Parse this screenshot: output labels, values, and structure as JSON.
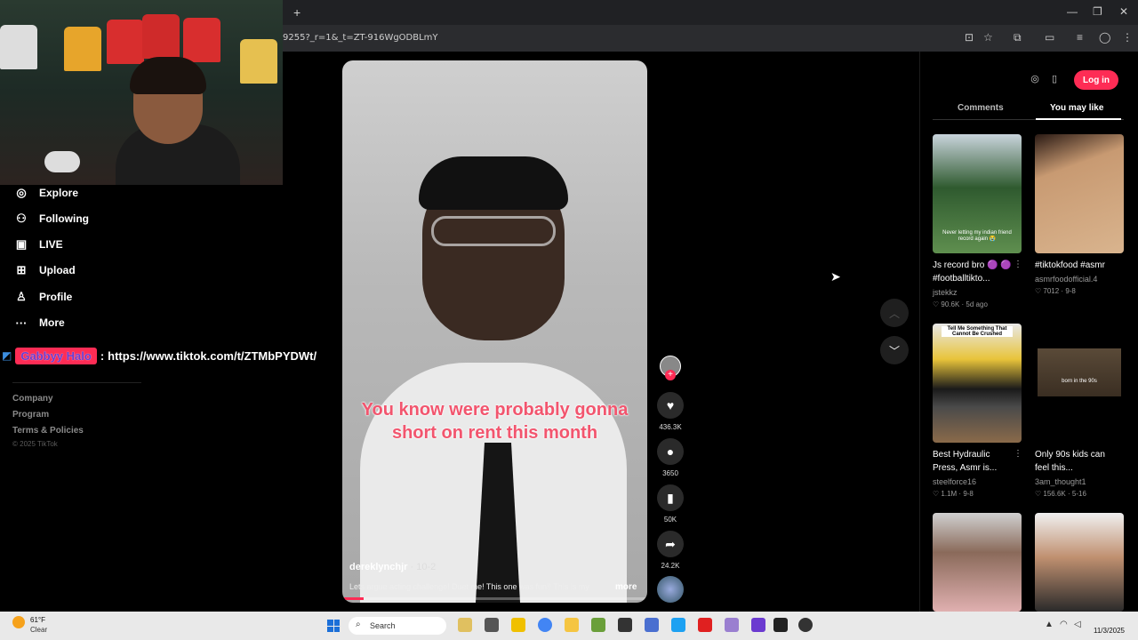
{
  "browser": {
    "new_tab_label": "+",
    "url": "9255?_r=1&_t=ZT-916WgODBLmY",
    "window_controls": [
      "—",
      "❐",
      "✕"
    ]
  },
  "nav": {
    "items": [
      {
        "label": "Explore",
        "icon": "compass-icon"
      },
      {
        "label": "Following",
        "icon": "following-icon"
      },
      {
        "label": "LIVE",
        "icon": "live-icon"
      },
      {
        "label": "Upload",
        "icon": "upload-icon"
      },
      {
        "label": "Profile",
        "icon": "profile-icon"
      },
      {
        "label": "More",
        "icon": "more-icon"
      }
    ],
    "footer_links": [
      "Company",
      "Program",
      "Terms & Policies"
    ],
    "copyright": "© 2025 TikTok"
  },
  "stream_overlay": {
    "name": "Gabbyy Halo",
    "separator": ":",
    "link": "https://www.tiktok.com/t/ZTMbPYDWt/"
  },
  "video": {
    "caption": "You know were probably gonna short on rent this month",
    "author": "dereklynchjr",
    "date": " · 10-2",
    "description": "Lets argue acting challenge! Duet me! This one was fun!! This is my",
    "more_label": "more",
    "progress": 0.07
  },
  "actions": {
    "likes": "436.3K",
    "comments": "3650",
    "saves": "50K",
    "shares": "24.2K"
  },
  "right_panel": {
    "login_label": "Log in",
    "tabs": [
      "Comments",
      "You may like"
    ],
    "active_tab": "You may like",
    "cards": [
      {
        "title": "Js record bro 🟣 🟣 #footballtikto...",
        "author": "jstekkz",
        "likes": "90.6K",
        "age": "5d ago",
        "thumb_text": "Never letting my indian friend record again 😭"
      },
      {
        "title": "#tiktokfood #asmr",
        "author": "asmrfoodofficial.4",
        "likes": "7012",
        "age": "9-8",
        "thumb_text": ""
      },
      {
        "title": "Best Hydraulic Press, Asmr is...",
        "author": "steelforce16",
        "likes": "1.1M",
        "age": "9-8",
        "thumb_text": "Tell Me Something That Cannot Be Crushed"
      },
      {
        "title": "Only 90s kids can feel this...",
        "author": "3am_thought1",
        "likes": "156.6K",
        "age": "5-16",
        "thumb_text": "born in the 90s"
      },
      {
        "title": "",
        "author": "",
        "likes": "",
        "age": "",
        "thumb_text": ""
      },
      {
        "title": "",
        "author": "",
        "likes": "",
        "age": "",
        "thumb_text": ""
      }
    ]
  },
  "taskbar": {
    "weather_temp": "61°F",
    "weather_desc": "Clear",
    "search_placeholder": "Search",
    "time": "11/3/2025",
    "date_label": "11/3/2025"
  },
  "colors": {
    "accent": "#fe2c55",
    "background": "#000000"
  }
}
